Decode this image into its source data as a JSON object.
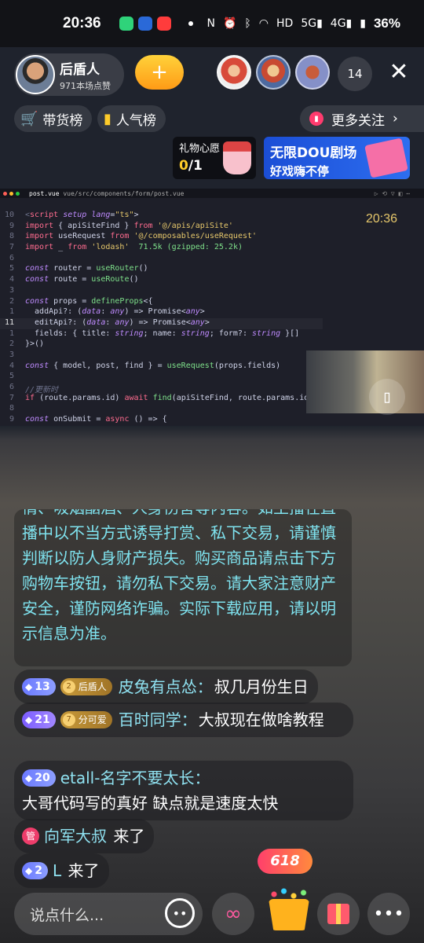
{
  "status_bar": {
    "time": "20:36",
    "battery": "36%"
  },
  "host": {
    "name": "后盾人",
    "likes": "971本场点赞"
  },
  "follow_button": {
    "symbol": "+"
  },
  "viewers": {
    "count": "14"
  },
  "close_button": {
    "symbol": "✕"
  },
  "top_tabs": {
    "shop_rank": "带货榜",
    "popularity_rank": "人气榜",
    "more_follow": "更多关注"
  },
  "gift_wish": {
    "title": "礼物心愿",
    "current": "0",
    "total": "/1"
  },
  "banner": {
    "line1": "无限DOU剧场",
    "line2": "好戏嗨不停"
  },
  "editor": {
    "tab_file": "post.vue",
    "path": "vue/src/components/form/post.vue",
    "overlay_time": "20:36",
    "lines": [
      {
        "n": "10",
        "html": "<span class='cm'>&lt;</span><span class='kw'>script</span> <span class='ty'>setup</span> <span class='ty'>lang</span>=<span class='str'>\"ts\"</span>&gt;"
      },
      {
        "n": "9",
        "html": "<span class='kw'>import</span> { apiSiteFind } <span class='kw'>from</span> <span class='str'>'@/apis/apiSite'</span>"
      },
      {
        "n": "8",
        "html": "<span class='kw'>import</span> useRequest <span class='kw'>from</span> <span class='str'>'@/composables/useRequest'</span>"
      },
      {
        "n": "7",
        "html": "<span class='kw'>import</span> _ <span class='kw'>from</span> <span class='str'>'lodash'</span>  <span class='fn'>71.5k (gzipped: 25.2k)</span>"
      },
      {
        "n": "6",
        "html": ""
      },
      {
        "n": "5",
        "html": "<span class='ty'>const</span> router = <span class='fn'>useRouter</span>()"
      },
      {
        "n": "4",
        "html": "<span class='ty'>const</span> route = <span class='fn'>useRoute</span>()"
      },
      {
        "n": "3",
        "html": ""
      },
      {
        "n": "2",
        "html": "<span class='ty'>const</span> props = <span class='fn'>defineProps</span>&lt;{"
      },
      {
        "n": "1",
        "html": "  addApi?: (<span class='ty'>data</span>: <span class='ty'>any</span>) =&gt; Promise&lt;<span class='ty'>any</span>&gt;"
      },
      {
        "n": "11",
        "html": "  editApi?: (<span class='ty'>data</span>: <span class='ty'>any</span>) =&gt; Promise&lt;<span class='ty'>any</span>&gt;",
        "current": true
      },
      {
        "n": "1",
        "html": "  fields: { title: <span class='ty'>string</span>; name: <span class='ty'>string</span>; form?: <span class='ty'>string</span> }[]"
      },
      {
        "n": "2",
        "html": "}&gt;()"
      },
      {
        "n": "3",
        "html": ""
      },
      {
        "n": "4",
        "html": "<span class='ty'>const</span> { model, post, find } = <span class='fn'>useRequest</span>(props.fields)"
      },
      {
        "n": "5",
        "html": ""
      },
      {
        "n": "6",
        "html": "<span class='cm'>//更新时</span>"
      },
      {
        "n": "7",
        "html": "<span class='kw'>if</span> (route.params.id) <span class='kw'>await</span> <span class='fn'>find</span>(apiSiteFind, route.params.id as"
      },
      {
        "n": "8",
        "html": ""
      },
      {
        "n": "9",
        "html": "<span class='ty'>const</span> onSubmit = <span class='kw'>async</span> () =&gt; {"
      }
    ]
  },
  "notice": {
    "text": "情、吸烟酗酒、人身伤害等内容。如主播在直播中以不当方式诱导打赏、私下交易，请谨慎判断以防人身财产损失。购买商品请点击下方购物车按钮，请勿私下交易。请大家注意财产安全，谨防网络诈骗。实际下载应用，请以明示信息为准。"
  },
  "messages": [
    {
      "level": "13",
      "fan": "后盾人",
      "fan_level": "2",
      "user": "皮兔有点怂：",
      "text": "叔几月份生日"
    },
    {
      "level": "21",
      "fan": "分可爱",
      "fan_level": "7",
      "user": "百时同学：",
      "text": "大叔现在做啥教程"
    },
    {
      "level": "20",
      "user": "etall-名字不要太长：",
      "text": "大哥代码写的真好  缺点就是速度太快"
    },
    {
      "badge": "管",
      "user": "向军大叔",
      "text": "来了"
    },
    {
      "level": "2",
      "user": "L",
      "text": "来了"
    }
  ],
  "bottom": {
    "input_placeholder": "说点什么...",
    "cart_badge": "618"
  }
}
